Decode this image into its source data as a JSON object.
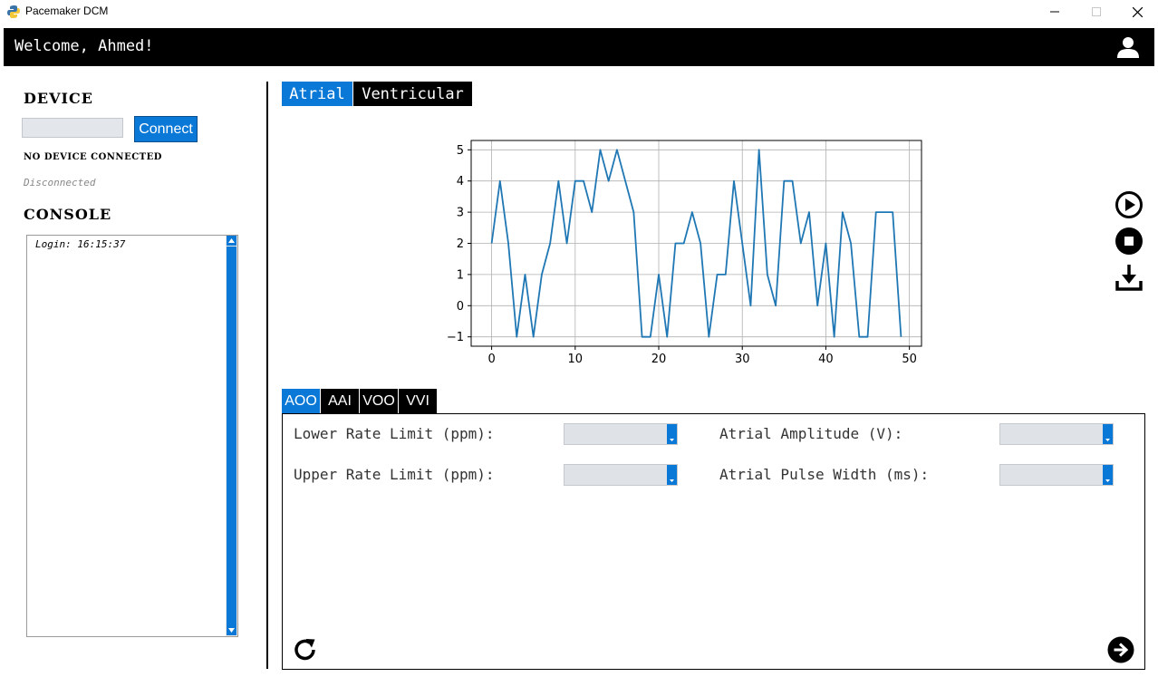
{
  "window": {
    "title": "Pacemaker DCM",
    "minimize_icon": "minimize-icon",
    "maximize_icon": "maximize-icon",
    "close_icon": "close-icon"
  },
  "header": {
    "welcome": "Welcome, Ahmed!",
    "user_icon": "user-icon",
    "background": "#000000"
  },
  "device": {
    "title": "DEVICE",
    "port_value": "",
    "connect_label": "Connect",
    "status": "NO DEVICE CONNECTED",
    "connection": "Disconnected"
  },
  "console": {
    "title": "CONSOLE",
    "lines": [
      "Login: 16:15:37"
    ]
  },
  "chamber_tabs": [
    {
      "label": "Atrial",
      "active": true
    },
    {
      "label": "Ventricular",
      "active": false
    }
  ],
  "mode_tabs": [
    {
      "label": "AOO",
      "active": true
    },
    {
      "label": "AAI",
      "active": false
    },
    {
      "label": "VOO",
      "active": false
    },
    {
      "label": "VVI",
      "active": false
    }
  ],
  "params": {
    "lower_rate": {
      "label": "Lower Rate Limit (ppm):",
      "value": ""
    },
    "upper_rate": {
      "label": "Upper Rate Limit (ppm):",
      "value": ""
    },
    "atrial_amplitude": {
      "label": "Atrial Amplitude (V):",
      "value": ""
    },
    "atrial_pulse_width": {
      "label": "Atrial Pulse Width (ms):",
      "value": ""
    }
  },
  "controls": {
    "play_icon": "play-icon",
    "stop_icon": "stop-icon",
    "download_icon": "download-icon",
    "reset_icon": "refresh-icon",
    "submit_icon": "arrow-right-icon"
  },
  "colors": {
    "accent": "#0a78d7",
    "line": "#1f77b4"
  },
  "chart_data": {
    "type": "line",
    "x": [
      0,
      1,
      2,
      3,
      4,
      5,
      6,
      7,
      8,
      9,
      10,
      11,
      12,
      13,
      14,
      15,
      16,
      17,
      18,
      19,
      20,
      21,
      22,
      23,
      24,
      25,
      26,
      27,
      28,
      29,
      30,
      31,
      32,
      33,
      34,
      35,
      36,
      37,
      38,
      39,
      40,
      41,
      42,
      43,
      44,
      45,
      46,
      47,
      48,
      49
    ],
    "y": [
      2,
      4,
      2,
      -1,
      1,
      -1,
      1,
      2,
      4,
      2,
      4,
      4,
      3,
      5,
      4,
      5,
      4,
      3,
      -1,
      -1,
      1,
      -1,
      2,
      2,
      3,
      2,
      -1,
      1,
      1,
      4,
      2,
      0,
      5,
      1,
      0,
      4,
      4,
      2,
      3,
      0,
      2,
      -1,
      3,
      2,
      -1,
      -1,
      3,
      3,
      3,
      -1
    ],
    "xticks": [
      0,
      10,
      20,
      30,
      40,
      50
    ],
    "yticks": [
      -1,
      0,
      1,
      2,
      3,
      4,
      5
    ],
    "xlim": [
      -2.45,
      51.45
    ],
    "ylim": [
      -1.3,
      5.3
    ],
    "grid": true,
    "title": "",
    "xlabel": "",
    "ylabel": ""
  }
}
